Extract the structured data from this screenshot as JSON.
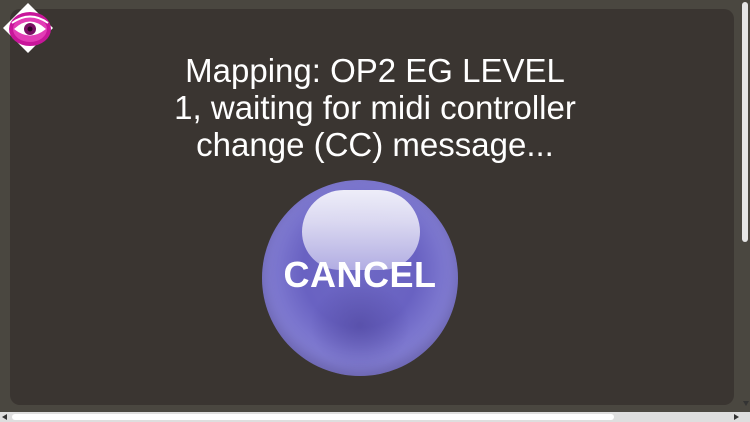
{
  "message": {
    "line1": "Mapping: OP2 EG LEVEL",
    "line2": "1, waiting for midi controller",
    "line3": "change (CC) message..."
  },
  "cancel_button": {
    "label": "CANCEL",
    "color": "#6e68c4"
  },
  "logo": {
    "icon": "eye-icon",
    "color": "#c8169a"
  },
  "colors": {
    "background": "#4a4740",
    "panel": "#3a3531",
    "text": "#ffffff"
  }
}
